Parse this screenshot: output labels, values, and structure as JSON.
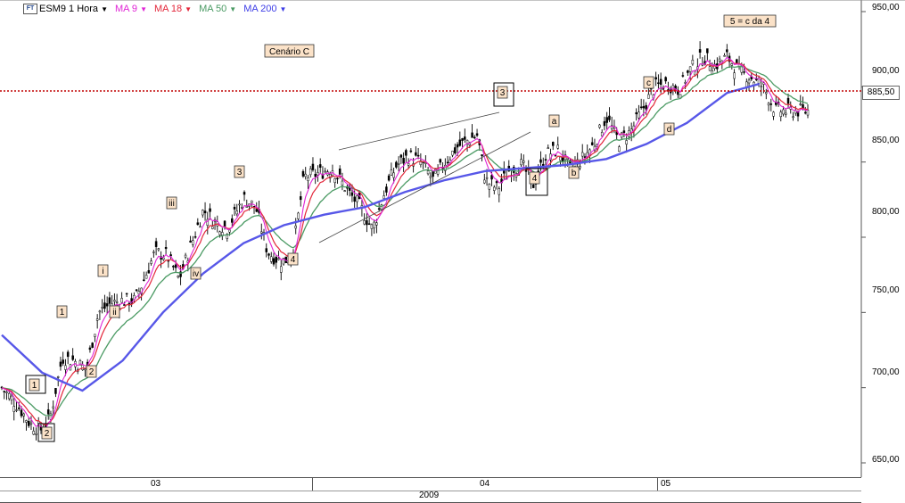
{
  "legend": {
    "symbol": "ESM9",
    "period": "1 Hora",
    "ma9_label": "MA 9",
    "ma18_label": "MA 18",
    "ma50_label": "MA 50",
    "ma200_label": "MA 200",
    "ma9_color": "#e024d6",
    "ma18_color": "#e3263a",
    "ma50_color": "#4a9a63",
    "ma200_color": "#3c3ce6"
  },
  "y_ticks": [
    "950,00",
    "900,00",
    "850,00",
    "800,00",
    "750,00",
    "700,00",
    "650,00"
  ],
  "price_tag": "885,50",
  "x_axis": {
    "months": [
      "03",
      "04",
      "05"
    ],
    "year": "2009"
  },
  "scenario_label": "Cenário C",
  "annotations": [
    "1",
    "2",
    "1",
    "2",
    "i",
    "ii",
    "iii",
    "iv",
    "3",
    "4",
    "3",
    "4",
    "a",
    "b",
    "c",
    "d",
    "5 = c da 4"
  ],
  "chart_data": {
    "type": "candlestick",
    "instrument": "ESM9",
    "timeframe": "1 Hora",
    "ylim": [
      640,
      960
    ],
    "current_price": 885.5,
    "close_path": [
      {
        "x": 0,
        "y": 700
      },
      {
        "x": 0.02,
        "y": 688
      },
      {
        "x": 0.035,
        "y": 676
      },
      {
        "x": 0.05,
        "y": 672
      },
      {
        "x": 0.06,
        "y": 680
      },
      {
        "x": 0.075,
        "y": 720
      },
      {
        "x": 0.09,
        "y": 718
      },
      {
        "x": 0.105,
        "y": 712
      },
      {
        "x": 0.12,
        "y": 750
      },
      {
        "x": 0.135,
        "y": 756
      },
      {
        "x": 0.15,
        "y": 758
      },
      {
        "x": 0.165,
        "y": 758
      },
      {
        "x": 0.175,
        "y": 770
      },
      {
        "x": 0.19,
        "y": 790
      },
      {
        "x": 0.205,
        "y": 788
      },
      {
        "x": 0.22,
        "y": 772
      },
      {
        "x": 0.235,
        "y": 795
      },
      {
        "x": 0.25,
        "y": 818
      },
      {
        "x": 0.265,
        "y": 810
      },
      {
        "x": 0.28,
        "y": 806
      },
      {
        "x": 0.3,
        "y": 826
      },
      {
        "x": 0.315,
        "y": 820
      },
      {
        "x": 0.33,
        "y": 790
      },
      {
        "x": 0.345,
        "y": 784
      },
      {
        "x": 0.36,
        "y": 786
      },
      {
        "x": 0.375,
        "y": 840
      },
      {
        "x": 0.39,
        "y": 842
      },
      {
        "x": 0.41,
        "y": 846
      },
      {
        "x": 0.43,
        "y": 830
      },
      {
        "x": 0.445,
        "y": 820
      },
      {
        "x": 0.46,
        "y": 805
      },
      {
        "x": 0.475,
        "y": 830
      },
      {
        "x": 0.49,
        "y": 848
      },
      {
        "x": 0.505,
        "y": 854
      },
      {
        "x": 0.52,
        "y": 850
      },
      {
        "x": 0.535,
        "y": 838
      },
      {
        "x": 0.55,
        "y": 850
      },
      {
        "x": 0.565,
        "y": 860
      },
      {
        "x": 0.58,
        "y": 865
      },
      {
        "x": 0.59,
        "y": 868
      },
      {
        "x": 0.6,
        "y": 838
      },
      {
        "x": 0.615,
        "y": 832
      },
      {
        "x": 0.63,
        "y": 845
      },
      {
        "x": 0.645,
        "y": 848
      },
      {
        "x": 0.66,
        "y": 835
      },
      {
        "x": 0.675,
        "y": 855
      },
      {
        "x": 0.69,
        "y": 858
      },
      {
        "x": 0.705,
        "y": 845
      },
      {
        "x": 0.72,
        "y": 852
      },
      {
        "x": 0.735,
        "y": 862
      },
      {
        "x": 0.75,
        "y": 880
      },
      {
        "x": 0.765,
        "y": 864
      },
      {
        "x": 0.78,
        "y": 870
      },
      {
        "x": 0.795,
        "y": 885
      },
      {
        "x": 0.81,
        "y": 900
      },
      {
        "x": 0.825,
        "y": 902
      },
      {
        "x": 0.84,
        "y": 898
      },
      {
        "x": 0.855,
        "y": 912
      },
      {
        "x": 0.87,
        "y": 920
      },
      {
        "x": 0.885,
        "y": 914
      },
      {
        "x": 0.9,
        "y": 920
      },
      {
        "x": 0.915,
        "y": 910
      },
      {
        "x": 0.93,
        "y": 906
      },
      {
        "x": 0.945,
        "y": 900
      },
      {
        "x": 0.96,
        "y": 884
      }
    ],
    "ma200_path": [
      {
        "x": 0,
        "y": 735
      },
      {
        "x": 0.05,
        "y": 710
      },
      {
        "x": 0.1,
        "y": 698
      },
      {
        "x": 0.15,
        "y": 718
      },
      {
        "x": 0.2,
        "y": 750
      },
      {
        "x": 0.25,
        "y": 776
      },
      {
        "x": 0.3,
        "y": 796
      },
      {
        "x": 0.35,
        "y": 808
      },
      {
        "x": 0.4,
        "y": 815
      },
      {
        "x": 0.45,
        "y": 820
      },
      {
        "x": 0.5,
        "y": 830
      },
      {
        "x": 0.55,
        "y": 838
      },
      {
        "x": 0.6,
        "y": 844
      },
      {
        "x": 0.65,
        "y": 846
      },
      {
        "x": 0.7,
        "y": 848
      },
      {
        "x": 0.75,
        "y": 852
      },
      {
        "x": 0.8,
        "y": 862
      },
      {
        "x": 0.85,
        "y": 876
      },
      {
        "x": 0.9,
        "y": 896
      },
      {
        "x": 0.94,
        "y": 902
      }
    ]
  }
}
